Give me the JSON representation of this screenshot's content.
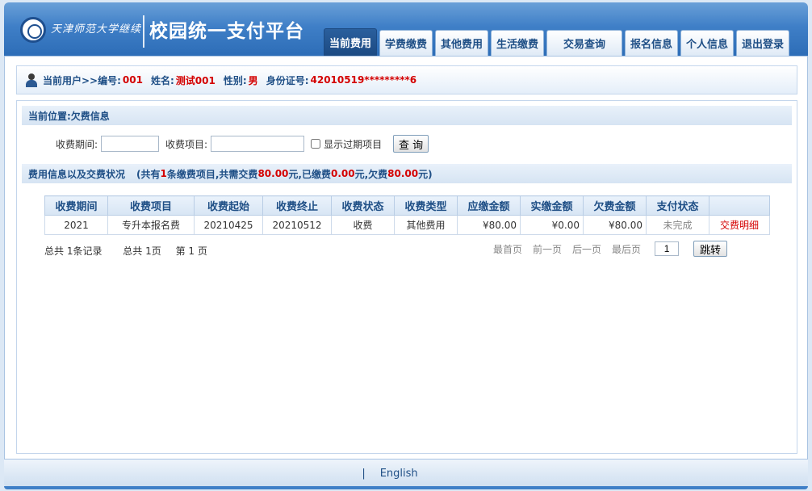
{
  "header": {
    "logo_text": "天津师范大学继续教育学院",
    "title": "校园统一支付平台"
  },
  "nav": {
    "tabs": [
      {
        "label": "当前费用",
        "active": true
      },
      {
        "label": "学费缴费",
        "active": false
      },
      {
        "label": "其他费用",
        "active": false
      },
      {
        "label": "生活缴费",
        "active": false
      },
      {
        "label": "交易查询",
        "active": false
      },
      {
        "label": "报名信息",
        "active": false
      },
      {
        "label": "个人信息",
        "active": false
      },
      {
        "label": "退出登录",
        "active": false
      }
    ]
  },
  "user": {
    "prefix": "当前用户>>编号:",
    "id": "001",
    "name_label": "姓名:",
    "name": "测试001",
    "gender_label": "性别:",
    "gender": "男",
    "idcard_label": "身份证号:",
    "idcard": "42010519*********6"
  },
  "location": {
    "text": "当前位置:欠费信息"
  },
  "query": {
    "period_label": "收费期间:",
    "period_value": "",
    "item_label": "收费项目:",
    "item_value": "",
    "expired_label": "显示过期项目",
    "expired_checked": false,
    "button_label": "查 询"
  },
  "summary": {
    "title": "费用信息以及交费状况",
    "p1": "(共有",
    "count": "1",
    "p2": "条缴费项目,共需交费",
    "total": "80.00",
    "p3": "元,已缴费",
    "paid": "0.00",
    "p4": "元,欠费",
    "owed": "80.00",
    "p5": "元)"
  },
  "table": {
    "columns": [
      "收费期间",
      "收费项目",
      "收费起始",
      "收费终止",
      "收费状态",
      "收费类型",
      "应缴金额",
      "实缴金额",
      "欠费金额",
      "支付状态",
      ""
    ],
    "rows": [
      [
        "2021",
        "专升本报名费",
        "20210425",
        "20210512",
        "收费",
        "其他费用",
        "¥80.00",
        "¥0.00",
        "¥80.00",
        "未完成",
        "交费明细"
      ]
    ]
  },
  "pager": {
    "total_records": "总共 1条记录",
    "total_pages": "总共 1页",
    "current_page": "第 1 页",
    "first": "最首页",
    "prev": "前一页",
    "next": "后一页",
    "last": "最后页",
    "page_value": "1",
    "jump_label": "跳转"
  },
  "footer": {
    "separator": "|",
    "language_link": "English"
  },
  "colors": {
    "brand_blue": "#3f7fc7",
    "nav_text": "#1f4f86",
    "highlight_red": "#d40000"
  }
}
